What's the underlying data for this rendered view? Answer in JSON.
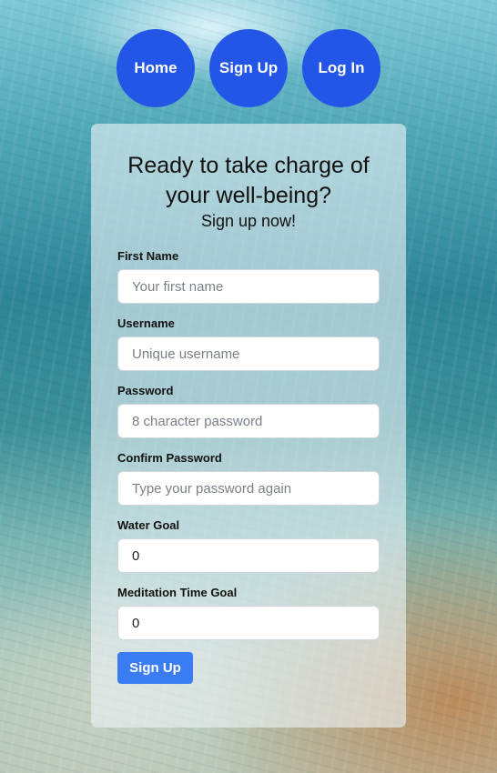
{
  "nav": {
    "items": [
      {
        "label": "Home"
      },
      {
        "label": "Sign Up"
      },
      {
        "label": "Log In"
      }
    ]
  },
  "card": {
    "heading": "Ready to take charge of your well-being?",
    "subheading": "Sign up now!"
  },
  "form": {
    "fields": [
      {
        "label": "First Name",
        "placeholder": "Your first name",
        "value": ""
      },
      {
        "label": "Username",
        "placeholder": "Unique username",
        "value": ""
      },
      {
        "label": "Password",
        "placeholder": "8 character password",
        "value": ""
      },
      {
        "label": "Confirm Password",
        "placeholder": "Type your password again",
        "value": ""
      },
      {
        "label": "Water Goal",
        "placeholder": "",
        "value": "0"
      },
      {
        "label": "Meditation Time Goal",
        "placeholder": "",
        "value": "0"
      }
    ],
    "submit_label": "Sign Up"
  },
  "colors": {
    "nav_button": "#2355e6",
    "submit_button": "#3c7cf2"
  }
}
